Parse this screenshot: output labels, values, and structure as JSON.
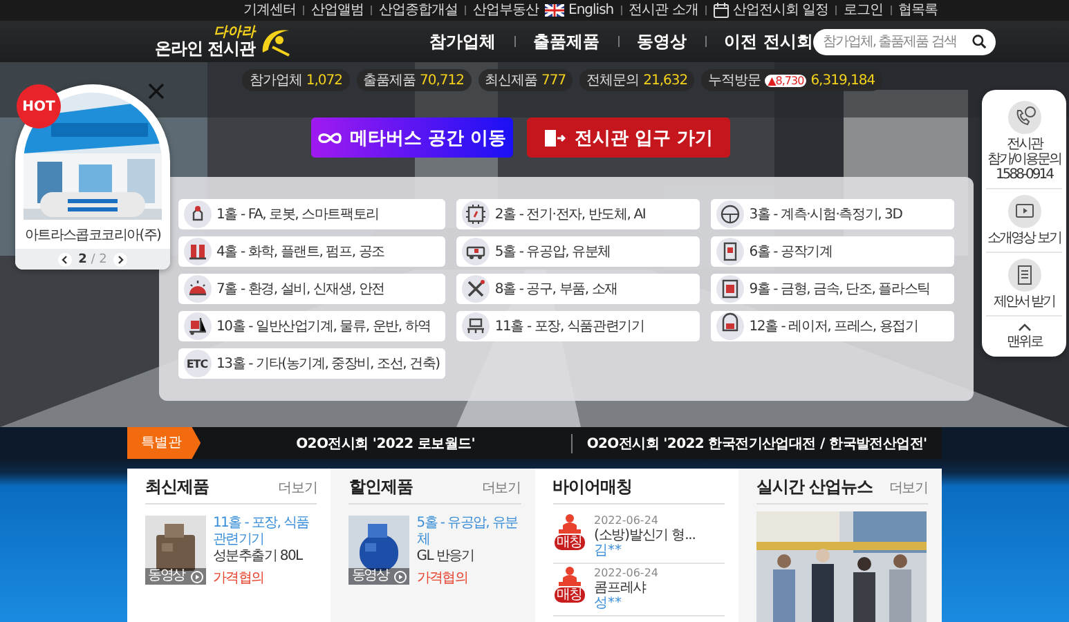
{
  "top_links_left": [
    "기계센터",
    "산업앨범",
    "산업종합개설",
    "산업부동산"
  ],
  "top_links_right": [
    {
      "label": "English",
      "kind": "flag"
    },
    {
      "label": "전시관 소개",
      "kind": "plain"
    },
    {
      "label": "산업전시회 일정",
      "kind": "calendar"
    },
    {
      "label": "로그인",
      "kind": "plain"
    },
    {
      "label": "협목록",
      "kind": "plain"
    }
  ],
  "logo": {
    "small": "다아라",
    "main": "온라인 전시관"
  },
  "nav": [
    "참가업체",
    "출품제품",
    "동영상",
    "이전 전시회"
  ],
  "search": {
    "placeholder": "참가업체, 출품제품 검색"
  },
  "stats": [
    {
      "label": "참가업체",
      "value": "1,072"
    },
    {
      "label": "출품제품",
      "value": "70,712"
    },
    {
      "label": "최신제품",
      "value": "777"
    },
    {
      "label": "전체문의",
      "value": "21,632"
    },
    {
      "label": "누적방문",
      "badge": "▲8,730",
      "value": "6,319,184"
    }
  ],
  "buttons": [
    {
      "label": "메타버스 공간 이동",
      "kind": "metaverse"
    },
    {
      "label": "전시관 입구 가기",
      "kind": "entrance"
    }
  ],
  "halls": [
    {
      "label": "1홀 - FA, 로봇, 스마트팩토리",
      "kind": "robot"
    },
    {
      "label": "2홀 - 전기·전자, 반도체, AI",
      "kind": "chip"
    },
    {
      "label": "3홀 - 계측·시험·측정기, 3D",
      "kind": "gauge"
    },
    {
      "label": "4홀 - 화학, 플랜트, 펌프, 공조",
      "kind": "tank"
    },
    {
      "label": "5홀 - 유공압, 유분체",
      "kind": "vehicle"
    },
    {
      "label": "6홀 - 공작기계",
      "kind": "machine"
    },
    {
      "label": "7홀 - 환경, 설비, 신재생, 안전",
      "kind": "dome"
    },
    {
      "label": "8홀 - 공구, 부품, 소재",
      "kind": "tools"
    },
    {
      "label": "9홀 - 금형, 금속, 단조, 플라스틱",
      "kind": "press"
    },
    {
      "label": "10홀 - 일반산업기계, 물류, 운반, 하역",
      "kind": "forklift"
    },
    {
      "label": "11홀 - 포장, 식품관련기기",
      "kind": "conveyor"
    },
    {
      "label": "12홀 - 레이저, 프레스, 용접기",
      "kind": "mask"
    },
    {
      "label": "13홀 - 기타(농기계, 중장비, 조선, 건축)",
      "kind": "text",
      "icon_text": "ETC"
    }
  ],
  "popup": {
    "badge": "HOT",
    "company": "아트라스콥코코리아(주)",
    "page": "2",
    "separator": "/",
    "total": "2"
  },
  "side_menu": [
    {
      "kind": "phone",
      "label": "전시관\n참가/이용문의\n1588-0914"
    },
    {
      "kind": "video",
      "label": "소개영상 보기"
    },
    {
      "kind": "document",
      "label": "제안서 받기"
    },
    {
      "kind": "top",
      "label": "맨위로"
    }
  ],
  "special": {
    "tag": "특별관",
    "items": [
      "O2O전시회 '2022 로보월드'",
      "O2O전시회 '2022 한국전기산업대전 / 한국발전산업전'"
    ]
  },
  "sections": [
    {
      "kind": "products",
      "title": "최신제품",
      "more": "더보기",
      "items": [
        {
          "category": "11홀 - 포장, 식품관련기기",
          "name": "성분추출기 80L",
          "price": "가격협의",
          "video": "동영상"
        }
      ]
    },
    {
      "kind": "products",
      "title": "할인제품",
      "more": "더보기",
      "items": [
        {
          "category": "5홀 - 유공압, 유분체",
          "name": "GL 반응기",
          "price": "가격협의",
          "video": "동영상"
        }
      ]
    },
    {
      "kind": "matching",
      "title": "바이어매칭",
      "items": [
        {
          "date": "2022-06-24",
          "title": "(소방)발신기 형...",
          "buyer": "김**",
          "badge": "매칭"
        },
        {
          "date": "2022-06-24",
          "title": "콤프레샤",
          "buyer": "성**",
          "badge": "매칭"
        }
      ]
    },
    {
      "kind": "news",
      "title": "실시간 산업뉴스",
      "more": "더보기"
    }
  ]
}
